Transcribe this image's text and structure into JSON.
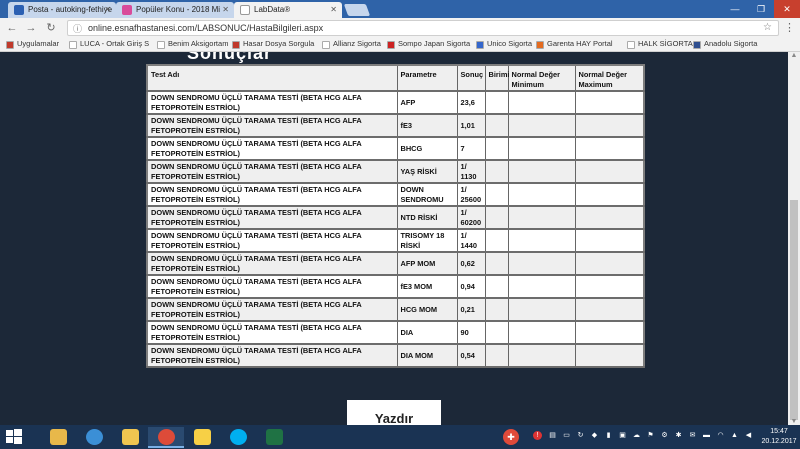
{
  "browser": {
    "tabs": [
      {
        "title": "Posta - autoking-fethiye",
        "active": false,
        "color": "#2a5fb2"
      },
      {
        "title": "Popüler Konu - 2018 Mi",
        "active": false,
        "color": "#d94b9a"
      },
      {
        "title": "LabData®",
        "active": true,
        "color": "#f2f2f2"
      }
    ],
    "url": "online.esnafhastanesi.com/LABSONUC/HastaBilgileri.aspx",
    "bookmarks": [
      {
        "label": "Uygulamalar",
        "color": "#c0392b"
      },
      {
        "label": "LUCA - Ortak Giriş S",
        "color": "#ffffff"
      },
      {
        "label": "Benim Aksigortam",
        "color": "#ffffff"
      },
      {
        "label": "Hasar Dosya Sorgula",
        "color": "#c0392b"
      },
      {
        "label": "Allianz Sigorta",
        "color": "#ffffff"
      },
      {
        "label": "Sompo Japan Sigorta",
        "color": "#cc2222"
      },
      {
        "label": "Unico Sigorta",
        "color": "#3366cc"
      },
      {
        "label": "Garenta HAY Portal",
        "color": "#e46b1f"
      },
      {
        "label": "HALK SİGORTA",
        "color": "#ffffff"
      },
      {
        "label": "Anadolu Sigorta",
        "color": "#2f4f8f"
      }
    ]
  },
  "page": {
    "heading_fragment": "Sonuçlar",
    "table": {
      "headers": [
        "Test Adı",
        "Parametre",
        "Sonuç",
        "Birimi",
        "Normal Değer Minimum",
        "Normal Değer Maximum"
      ],
      "rows": [
        {
          "test": "DOWN SENDROMU ÜÇLÜ TARAMA TESTİ (BETA HCG ALFA FETOPROTEİN ESTRİOL)",
          "param": "AFP",
          "result": "23,6",
          "unit": "",
          "min": "",
          "max": ""
        },
        {
          "test": "DOWN SENDROMU ÜÇLÜ TARAMA TESTİ (BETA HCG ALFA FETOPROTEİN ESTRİOL)",
          "param": "fE3",
          "result": "1,01",
          "unit": "",
          "min": "",
          "max": ""
        },
        {
          "test": "DOWN SENDROMU ÜÇLÜ TARAMA TESTİ (BETA HCG ALFA FETOPROTEİN ESTRİOL)",
          "param": "BHCG",
          "result": "7",
          "unit": "",
          "min": "",
          "max": ""
        },
        {
          "test": "DOWN SENDROMU ÜÇLÜ TARAMA TESTİ (BETA HCG ALFA FETOPROTEİN ESTRİOL)",
          "param": "YAŞ RİSKİ",
          "result": "1/ 1130",
          "unit": "",
          "min": "",
          "max": ""
        },
        {
          "test": "DOWN SENDROMU ÜÇLÜ TARAMA TESTİ (BETA HCG ALFA FETOPROTEİN ESTRİOL)",
          "param": "DOWN SENDROMU",
          "result": "1/ 25600",
          "unit": "",
          "min": "",
          "max": ""
        },
        {
          "test": "DOWN SENDROMU ÜÇLÜ TARAMA TESTİ (BETA HCG ALFA FETOPROTEİN ESTRİOL)",
          "param": "NTD RİSKİ",
          "result": "1/ 60200",
          "unit": "",
          "min": "",
          "max": ""
        },
        {
          "test": "DOWN SENDROMU ÜÇLÜ TARAMA TESTİ (BETA HCG ALFA FETOPROTEİN ESTRİOL)",
          "param": "TRISOMY 18 RİSKİ",
          "result": "1/ 1440",
          "unit": "",
          "min": "",
          "max": ""
        },
        {
          "test": "DOWN SENDROMU ÜÇLÜ TARAMA TESTİ (BETA HCG ALFA FETOPROTEİN ESTRİOL)",
          "param": "AFP MOM",
          "result": "0,62",
          "unit": "",
          "min": "",
          "max": ""
        },
        {
          "test": "DOWN SENDROMU ÜÇLÜ TARAMA TESTİ (BETA HCG ALFA FETOPROTEİN ESTRİOL)",
          "param": "fE3 MOM",
          "result": "0,94",
          "unit": "",
          "min": "",
          "max": ""
        },
        {
          "test": "DOWN SENDROMU ÜÇLÜ TARAMA TESTİ (BETA HCG ALFA FETOPROTEİN ESTRİOL)",
          "param": "HCG MOM",
          "result": "0,21",
          "unit": "",
          "min": "",
          "max": ""
        },
        {
          "test": "DOWN SENDROMU ÜÇLÜ TARAMA TESTİ (BETA HCG ALFA FETOPROTEİN ESTRİOL)",
          "param": "DIA",
          "result": "90",
          "unit": "",
          "min": "",
          "max": ""
        },
        {
          "test": "DOWN SENDROMU ÜÇLÜ TARAMA TESTİ (BETA HCG ALFA FETOPROTEİN ESTRİOL)",
          "param": "DIA MOM",
          "result": "0,54",
          "unit": "",
          "min": "",
          "max": ""
        }
      ]
    },
    "print_label": "Yazdır"
  },
  "taskbar": {
    "apps": [
      {
        "name": "file-explorer",
        "color": "#e8b84a",
        "active": false
      },
      {
        "name": "internet-explorer",
        "color": "#3b8fd6",
        "active": false
      },
      {
        "name": "folder",
        "color": "#f0c550",
        "active": false
      },
      {
        "name": "chrome",
        "color": "#dd4b39",
        "active": true
      },
      {
        "name": "akis",
        "color": "#f7d046",
        "active": false
      },
      {
        "name": "skype",
        "color": "#00aff0",
        "active": false
      },
      {
        "name": "excel",
        "color": "#1f7244",
        "active": false
      }
    ],
    "time": "15:47",
    "date": "20.12.2017"
  }
}
